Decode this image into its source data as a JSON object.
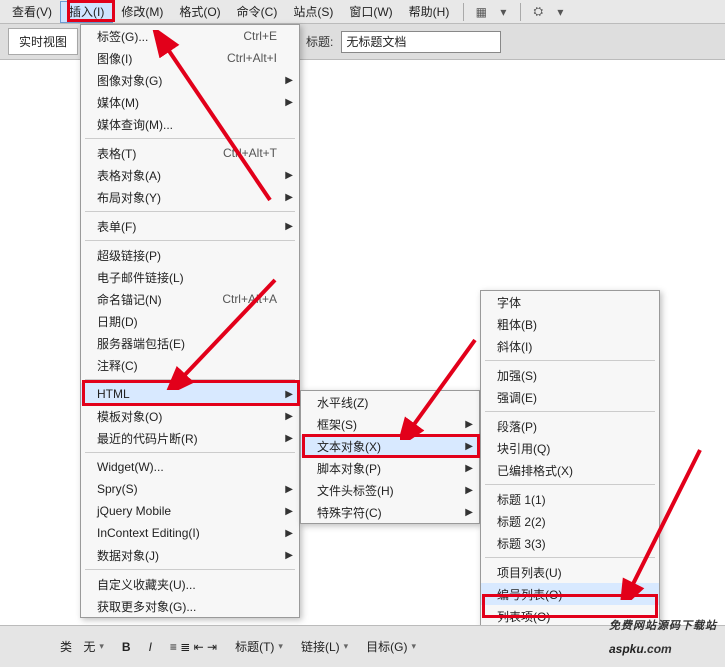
{
  "menubar": {
    "items": [
      "查看(V)",
      "插入(I)",
      "修改(M)",
      "格式(O)",
      "命令(C)",
      "站点(S)",
      "窗口(W)",
      "帮助(H)"
    ]
  },
  "toolbar": {
    "realtime_tab": "实时视图",
    "title_label": "标题:",
    "title_value": "无标题文档"
  },
  "insert_menu": [
    {
      "label": "标签(G)...",
      "sc": "Ctrl+E"
    },
    {
      "label": "图像(I)",
      "sc": "Ctrl+Alt+I"
    },
    {
      "label": "图像对象(G)",
      "sub": true
    },
    {
      "label": "媒体(M)",
      "sub": true
    },
    {
      "label": "媒体查询(M)..."
    },
    {
      "sep": true
    },
    {
      "label": "表格(T)",
      "sc": "Ctrl+Alt+T"
    },
    {
      "label": "表格对象(A)",
      "sub": true
    },
    {
      "label": "布局对象(Y)",
      "sub": true
    },
    {
      "sep": true
    },
    {
      "label": "表单(F)",
      "sub": true
    },
    {
      "sep": true
    },
    {
      "label": "超级链接(P)"
    },
    {
      "label": "电子邮件链接(L)"
    },
    {
      "label": "命名锚记(N)",
      "sc": "Ctrl+Alt+A"
    },
    {
      "label": "日期(D)"
    },
    {
      "label": "服务器端包括(E)"
    },
    {
      "label": "注释(C)"
    },
    {
      "sep": true
    },
    {
      "label": "HTML",
      "sub": true,
      "sel": true
    },
    {
      "label": "模板对象(O)",
      "sub": true
    },
    {
      "label": "最近的代码片断(R)",
      "sub": true
    },
    {
      "sep": true
    },
    {
      "label": "Widget(W)..."
    },
    {
      "label": "Spry(S)",
      "sub": true
    },
    {
      "label": "jQuery Mobile",
      "sub": true
    },
    {
      "label": "InContext Editing(I)",
      "sub": true
    },
    {
      "label": "数据对象(J)",
      "sub": true
    },
    {
      "sep": true
    },
    {
      "label": "自定义收藏夹(U)..."
    },
    {
      "label": "获取更多对象(G)..."
    }
  ],
  "html_submenu": [
    {
      "label": "水平线(Z)"
    },
    {
      "label": "框架(S)",
      "sub": true
    },
    {
      "label": "文本对象(X)",
      "sub": true,
      "sel": true
    },
    {
      "label": "脚本对象(P)",
      "sub": true
    },
    {
      "label": "文件头标签(H)",
      "sub": true
    },
    {
      "label": "特殊字符(C)",
      "sub": true
    }
  ],
  "text_submenu": [
    {
      "label": "字体"
    },
    {
      "label": "粗体(B)"
    },
    {
      "label": "斜体(I)"
    },
    {
      "sep": true
    },
    {
      "label": "加强(S)"
    },
    {
      "label": "强调(E)"
    },
    {
      "sep": true
    },
    {
      "label": "段落(P)"
    },
    {
      "label": "块引用(Q)"
    },
    {
      "label": "已编排格式(X)"
    },
    {
      "sep": true
    },
    {
      "label": "标题 1(1)"
    },
    {
      "label": "标题 2(2)"
    },
    {
      "label": "标题 3(3)"
    },
    {
      "sep": true
    },
    {
      "label": "项目列表(U)"
    },
    {
      "label": "编号列表(O)",
      "sel": true
    },
    {
      "label": "列表项(O)"
    }
  ],
  "bottom": {
    "kind_label": "类",
    "kind_value": "无",
    "link_label": "链接(L)",
    "bold": "B",
    "italic": "I",
    "title_h": "标题(T)",
    "target": "目标(G)"
  },
  "watermark": {
    "brand": "aspku",
    "tld": ".com",
    "sub": "免费网站源码下载站"
  }
}
